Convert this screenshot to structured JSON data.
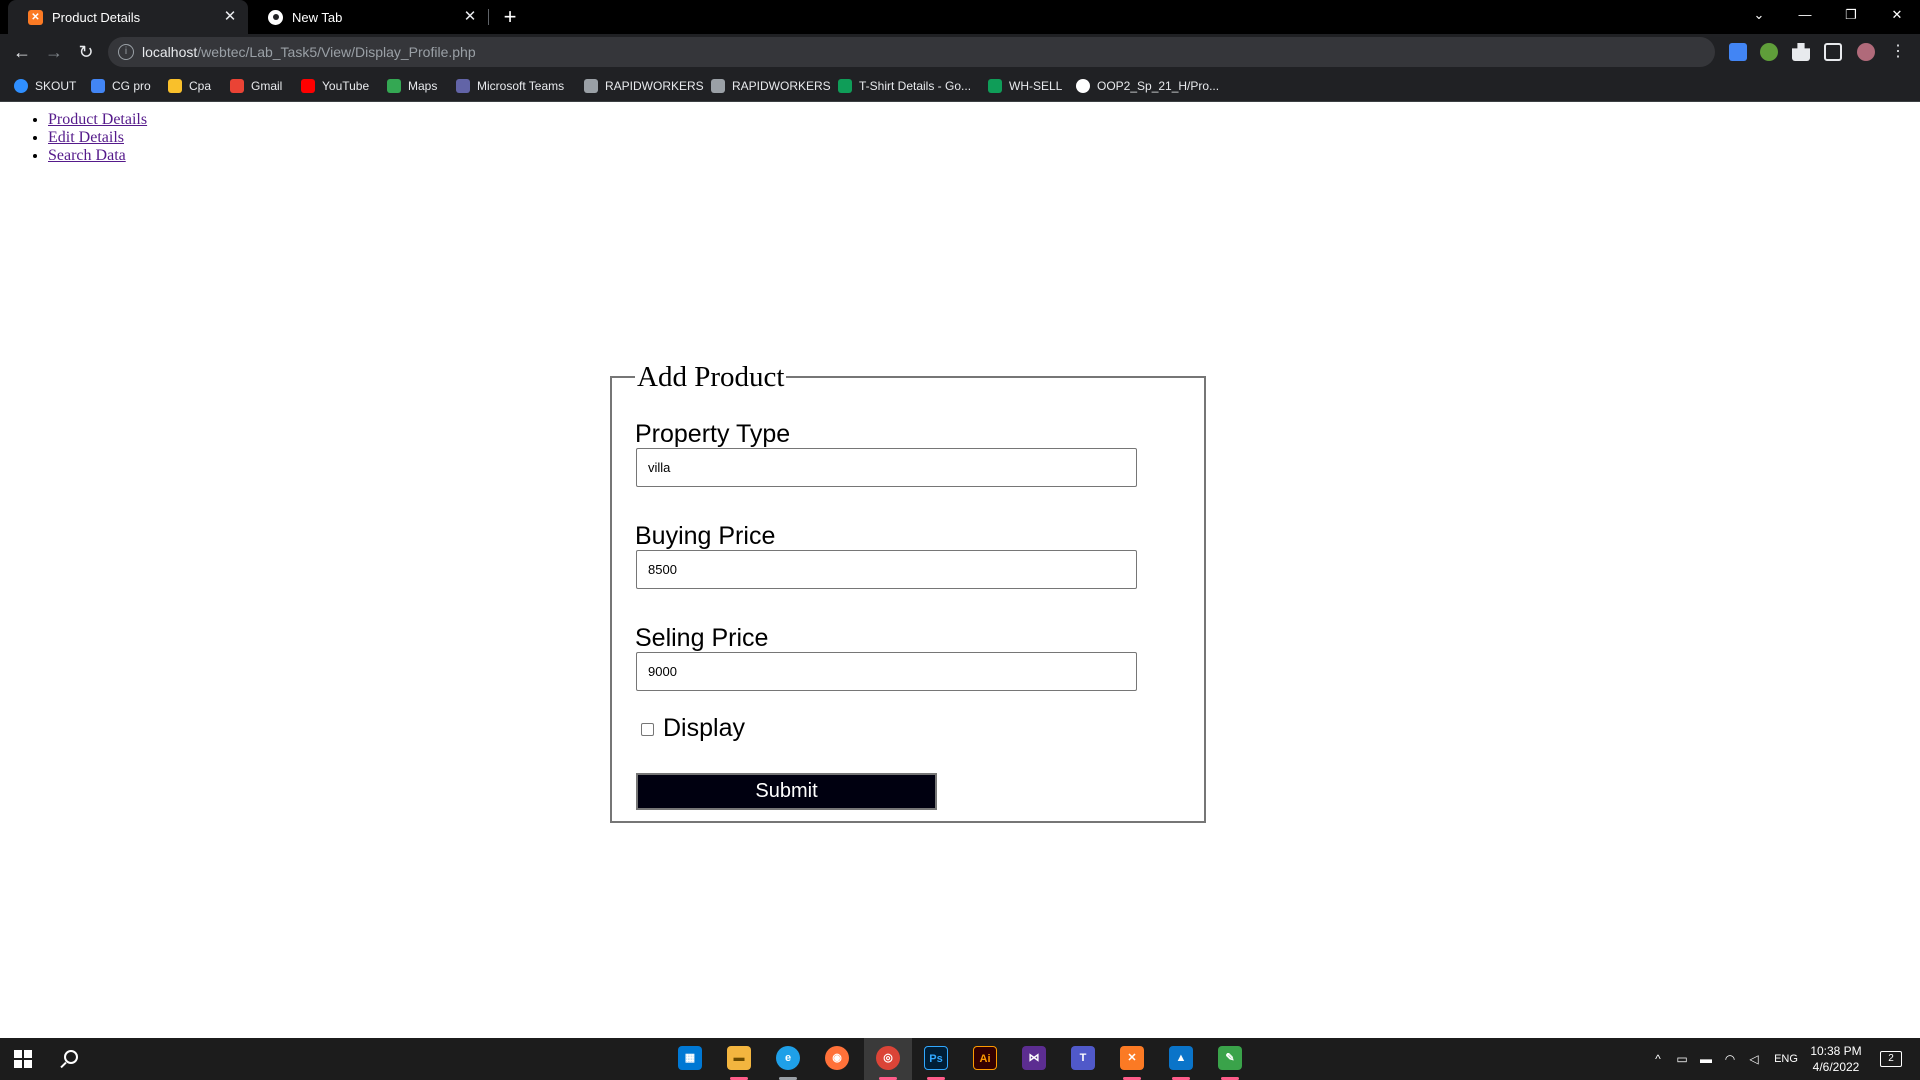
{
  "browser": {
    "tabs": [
      {
        "title": "Product Details",
        "active": true,
        "icon": "xampp-icon"
      },
      {
        "title": "New Tab",
        "active": false,
        "icon": "chrome-icon"
      }
    ],
    "new_tab_symbol": "+",
    "window_controls": {
      "tab_search": "⌄",
      "minimize": "—",
      "restore": "❐",
      "close": "✕"
    },
    "nav": {
      "back": "←",
      "forward": "→",
      "reload": "↻"
    },
    "url": {
      "host": "localhost",
      "path": "/webtec/Lab_Task5/View/Display_Profile.php",
      "info_icon": "i"
    },
    "bookmarks": [
      {
        "label": "SKOUT",
        "icon": "skout-icon",
        "color": "#2f8fff"
      },
      {
        "label": "CG pro",
        "icon": "docs-icon",
        "color": "#4285f4"
      },
      {
        "label": "Cpa",
        "icon": "folder-icon",
        "color": "#f9c02b"
      },
      {
        "label": "Gmail",
        "icon": "gmail-icon",
        "color": "#ea4335"
      },
      {
        "label": "YouTube",
        "icon": "youtube-icon",
        "color": "#ff0000"
      },
      {
        "label": "Maps",
        "icon": "maps-icon",
        "color": "#34a853"
      },
      {
        "label": "Microsoft Teams",
        "icon": "teams-icon",
        "color": "#6264a7"
      },
      {
        "label": "RAPIDWORKERS",
        "icon": "rapidworkers-icon",
        "color": "#9aa0a6"
      },
      {
        "label": "RAPIDWORKERS",
        "icon": "rapidworkers-icon",
        "color": "#9aa0a6"
      },
      {
        "label": "T-Shirt Details - Go...",
        "icon": "sheets-icon",
        "color": "#0f9d58"
      },
      {
        "label": "WH-SELL",
        "icon": "sheets-icon",
        "color": "#0f9d58"
      },
      {
        "label": "OOP2_Sp_21_H/Pro...",
        "icon": "github-icon",
        "color": "#ffffff"
      }
    ]
  },
  "page": {
    "nav_links": [
      "Product Details",
      "Edit Details",
      "Search Data"
    ],
    "form": {
      "legend": "Add Product",
      "fields": [
        {
          "label": "Property Type",
          "value": "villa"
        },
        {
          "label": "Buying Price",
          "value": "8500"
        },
        {
          "label": "Seling Price",
          "value": "9000"
        }
      ],
      "checkbox": {
        "label": "Display",
        "checked": false
      },
      "submit_label": "Submit"
    }
  },
  "taskbar": {
    "apps": [
      {
        "name": "store-icon",
        "color": "#0078d4",
        "glyph": "▦"
      },
      {
        "name": "file-explorer-icon",
        "color": "#f3b53f",
        "glyph": "▬"
      },
      {
        "name": "edge-icon",
        "color": "#1fa0e8",
        "glyph": "e"
      },
      {
        "name": "firefox-icon",
        "color": "#ff7139",
        "glyph": "◉"
      },
      {
        "name": "chrome-icon",
        "color": "#db4437",
        "glyph": "◎"
      },
      {
        "name": "photoshop-icon",
        "color": "#001e36",
        "glyph": "Ps"
      },
      {
        "name": "illustrator-icon",
        "color": "#330000",
        "glyph": "Ai"
      },
      {
        "name": "visual-studio-icon",
        "color": "#5c2d91",
        "glyph": "⋈"
      },
      {
        "name": "teams-icon",
        "color": "#5059c9",
        "glyph": "T"
      },
      {
        "name": "xampp-icon",
        "color": "#fb7a24",
        "glyph": "✕"
      },
      {
        "name": "photos-icon",
        "color": "#0a74c9",
        "glyph": "▲"
      },
      {
        "name": "notepad-icon",
        "color": "#3aa34a",
        "glyph": "✎"
      }
    ],
    "tray": {
      "language": "ENG",
      "time": "10:38 PM",
      "date": "4/6/2022",
      "notifications": "2"
    }
  }
}
